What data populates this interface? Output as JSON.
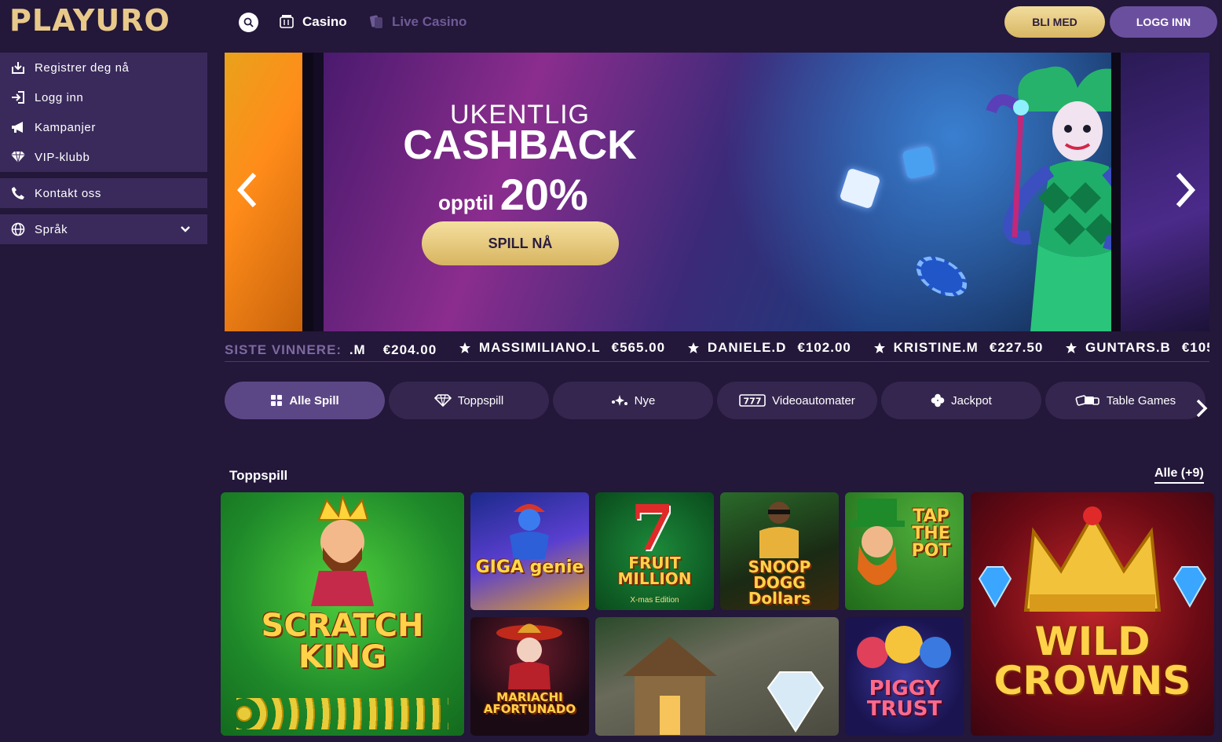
{
  "header": {
    "logo_text": "PLAYURO",
    "nav": [
      {
        "label": "Casino",
        "active": true
      },
      {
        "label": "Live Casino",
        "active": false
      }
    ],
    "join_label": "BLI MED",
    "login_label": "LOGG INN"
  },
  "sidebar": {
    "items": [
      {
        "label": "Registrer deg nå",
        "icon": "register-icon"
      },
      {
        "label": "Logg inn",
        "icon": "login-icon"
      },
      {
        "label": "Kampanjer",
        "icon": "megaphone-icon"
      },
      {
        "label": "VIP-klubb",
        "icon": "diamond-icon"
      }
    ],
    "contact_label": "Kontakt oss",
    "language_label": "Språk"
  },
  "banner": {
    "line1": "UKENTLIG",
    "line2": "CASHBACK",
    "line3_small": "opptil",
    "line3_big": "20%",
    "cta_label": "SPILL NÅ"
  },
  "winners": {
    "label": "SISTE VINNERE:",
    "entries": [
      {
        "name": ".M",
        "amount": "€204.00"
      },
      {
        "name": "MASSIMILIANO.L",
        "amount": "€565.00"
      },
      {
        "name": "DANIELE.D",
        "amount": "€102.00"
      },
      {
        "name": "KRISTINE.M",
        "amount": "€227.50"
      },
      {
        "name": "GUNTARS.B",
        "amount": "€105."
      }
    ]
  },
  "categories": [
    {
      "label": "Alle Spill",
      "icon": "grid-icon",
      "active": true
    },
    {
      "label": "Toppspill",
      "icon": "diamond-icon",
      "active": false
    },
    {
      "label": "Nye",
      "icon": "sparkle-icon",
      "active": false
    },
    {
      "label": "Videoautomater",
      "icon": "slot-777-icon",
      "active": false
    },
    {
      "label": "Jackpot",
      "icon": "clover-icon",
      "active": false
    },
    {
      "label": "Table Games",
      "icon": "cards-icon",
      "active": false
    }
  ],
  "section": {
    "title": "Toppspill",
    "all_label": "Alle (+9)"
  },
  "games": [
    {
      "name": "SCRATCH KING"
    },
    {
      "name": "GIGA genie"
    },
    {
      "name": "FRUIT MILLION",
      "sub": "X-mas Edition"
    },
    {
      "name": "SNOOP DOGG Dollars"
    },
    {
      "name": "TAP THE POT"
    },
    {
      "name": "WILD CROWNS"
    },
    {
      "name": "MARIACHI AFORTUNADO"
    },
    {
      "name": ""
    },
    {
      "name": "PIGGY TRUST"
    }
  ],
  "colors": {
    "background": "#23173a",
    "sidebar": "#3a2a5c",
    "gold": "#e8c98a",
    "purple_button": "#6b4f9f"
  }
}
